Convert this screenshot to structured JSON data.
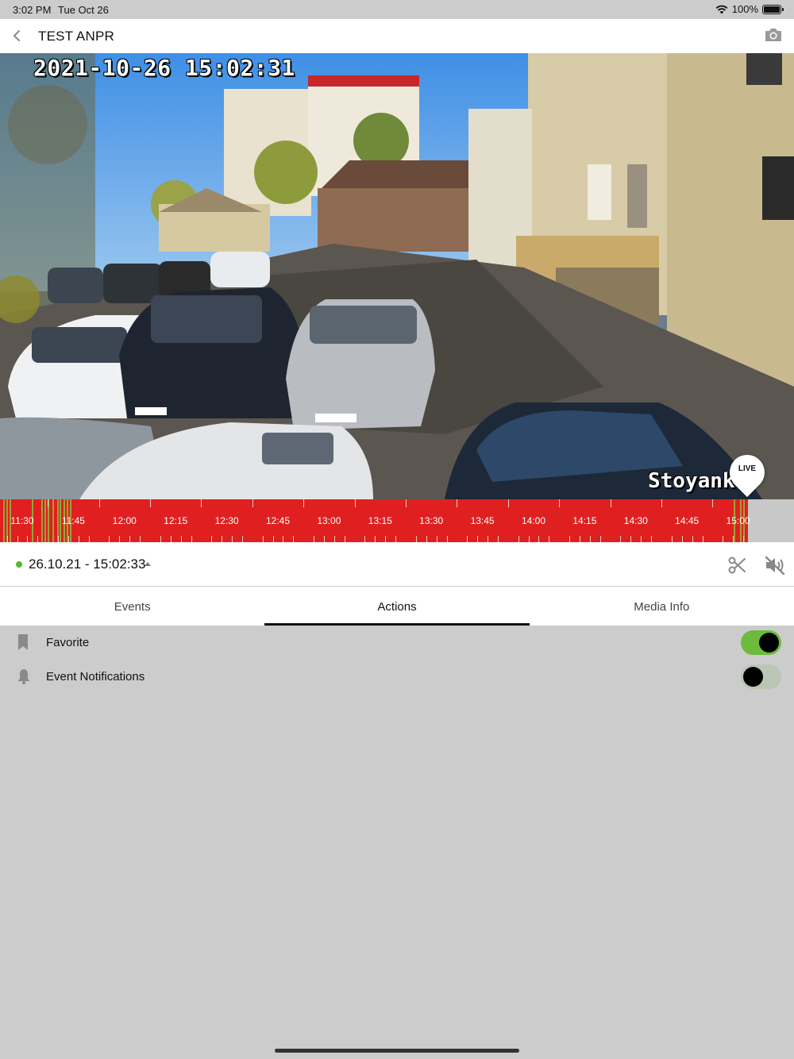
{
  "status_bar": {
    "time": "3:02 PM",
    "date": "Tue Oct 26",
    "battery": "100%",
    "icons": [
      "wifi-icon",
      "battery-icon"
    ]
  },
  "nav": {
    "back_icon": "chevron-left-icon",
    "title": "TEST ANPR",
    "snapshot_icon": "camera-icon"
  },
  "video": {
    "osd_timestamp": "2021-10-26 15:02:31",
    "osd_camera_name": "Stoyank",
    "live_label": "LIVE"
  },
  "timeline": {
    "labels": [
      "11:30",
      "11:45",
      "12:00",
      "12:15",
      "12:30",
      "12:45",
      "13:00",
      "13:15",
      "13:30",
      "13:45",
      "14:00",
      "14:15",
      "14:30",
      "14:45",
      "15:00"
    ],
    "recording_color": "#e02020",
    "event_marker_color": "#8ac43f"
  },
  "playback": {
    "status_color": "#5cb531",
    "datetime": "26.10.21 - 15:02:33",
    "icons": [
      "scissors-icon",
      "speaker-mute-icon"
    ]
  },
  "tabs": [
    {
      "label": "Events",
      "active": false
    },
    {
      "label": "Actions",
      "active": true
    },
    {
      "label": "Media Info",
      "active": false
    }
  ],
  "actions": [
    {
      "label": "Favorite",
      "icon": "bookmark-icon",
      "enabled": true
    },
    {
      "label": "Event Notifications",
      "icon": "bell-icon",
      "enabled": false
    }
  ],
  "colors": {
    "toggle_on": "#6cbb3c",
    "toggle_off": "#b9c6b4",
    "background": "#cccccc"
  }
}
